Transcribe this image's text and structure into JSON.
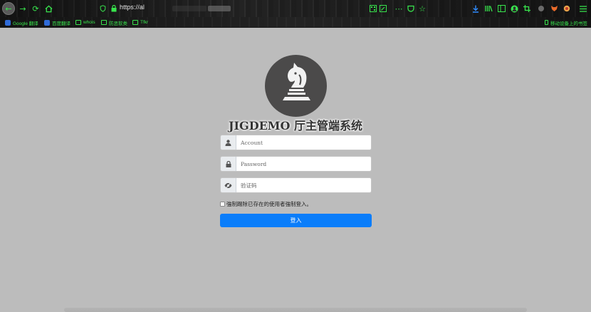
{
  "browser": {
    "url": "https://al",
    "bookmarks": [
      "Google 翻译",
      "百度翻译",
      "whois",
      "防恶软类",
      "Tfkr"
    ],
    "mobile_bookmarks": "移动设备上的书签"
  },
  "login": {
    "title": "JIGDEMO 厅主管端系统",
    "account_placeholder": "Account",
    "password_placeholder": "Password",
    "captcha_placeholder": "验证码",
    "force_login_label": "強制踢除已存在的使用者強制登入。",
    "submit_label": "登入"
  },
  "colors": {
    "accent": "#0a7dfa",
    "background": "#bcbcbc",
    "logo_bg": "#4b4a4a",
    "toolbar_icon": "#38e54d"
  },
  "icons": [
    "back-arrow-icon",
    "forward-arrow-icon",
    "reload-icon",
    "home-icon",
    "shield-icon",
    "lock-icon",
    "qr-icon",
    "edit-icon",
    "more-icon",
    "pocket-icon",
    "star-icon",
    "download-icon",
    "library-icon",
    "sidebar-icon",
    "account-icon",
    "crop-icon",
    "extension-icon",
    "menu-icon",
    "chess-knight-icon",
    "user-icon",
    "password-lock-icon",
    "eye-slash-icon"
  ]
}
